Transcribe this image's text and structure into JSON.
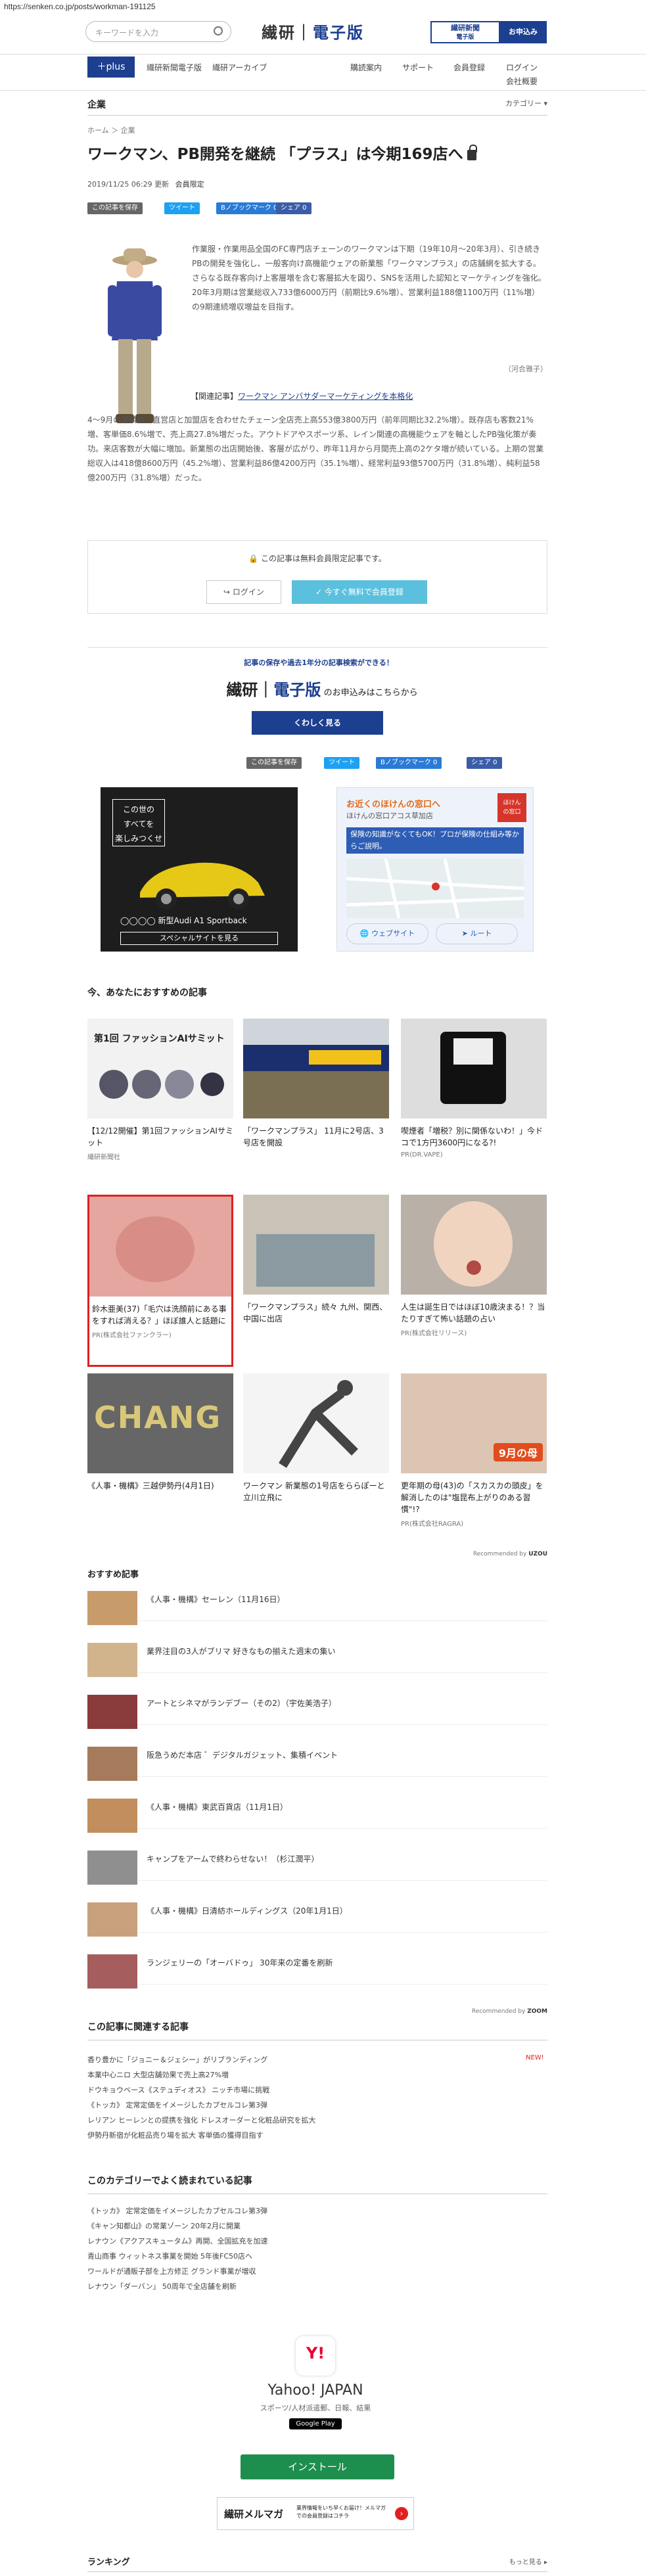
{
  "url": "https://senken.co.jp/posts/workman-191125",
  "header": {
    "search_placeholder": "キーワードを入力",
    "logo_a": "繊研",
    "logo_b": "電子版",
    "shinbun_line1": "繊研新聞",
    "shinbun_line2": "電子版",
    "subscribe": "お申込み"
  },
  "nav": {
    "plus": "plus",
    "items": [
      "繊研新聞電子版",
      "繊研アーカイブ",
      "購読案内",
      "サポート",
      "会員登録",
      "ログイン",
      "会社概要"
    ]
  },
  "category": {
    "title": "企業",
    "menu": "カテゴリー ▾"
  },
  "breadcrumb": "ホーム ＞ 企業",
  "article": {
    "title": "ワークマン、PB開発を継続 「プラス」は今期169店へ",
    "date": "2019/11/25 06:29 更新",
    "member_label": "会員限定",
    "share": {
      "save": "この記事を保存",
      "tweet": "ツイート",
      "bookmark": "Bノブックマーク 0",
      "facebook": "シェア 0"
    },
    "p1": [
      "作業服・作業用品全国のFC専門店チェーンのワークマンは下期（19年10月～20年3月）、引き続きPBの開発を強化し、一般客向け高機能ウェアの新業態「ワークマンプラス」の店舗網を拡大する。さらなる既存客向け上客層増を含む客層拡大を図り、SNSを活用した認知とマーケティングを強化。20年3月期は営業総収入733億6000万円（前期比9.6%増）、営業利益188億1100万円（11%増）の9期連続増収増益を目指す。"
    ],
    "author": "（河合雅子）",
    "related_prefix": "【関連記事】",
    "related_link": "ワークマン アンバサダーマーケティングを本格化",
    "p2": "4～9月の業績は、直営店と加盟店を合わせたチェーン全店売上高553億3800万円（前年同期比32.2%増）。既存店も客数21%増、客単価8.6%増で、売上高27.8%増だった。アウトドアやスポーツ系、レイン関連の高機能ウェアを軸としたPB強化策が奏功。来店客数が大幅に増加。新業態の出店開始後、客層が広がり、昨年11月から月間売上高の2ケタ増が続いている。上期の営業総収入は418億8600万円（45.2%増）、営業利益86億4200万円（35.1%増）、経常利益93億5700万円（31.8%増）、純利益58億200万円（31.8%増）だった。"
  },
  "members": {
    "msg": "この記事は無料会員限定記事です。",
    "login": "ログイン",
    "register": "今すぐ無料で会員登録"
  },
  "promo": {
    "band": "記事の保存や過去1年分の記事検索ができる！",
    "tail": "のお申込みはこちらから",
    "button": "くわしく見る"
  },
  "ads": {
    "car_top1": "この世の",
    "car_top2": "すべてを",
    "car_top3": "楽しみつくせ",
    "car_model": "新型Audi A1 Sportback",
    "car_btn": "スペシャルサイトを見る",
    "ins_title": "お近くのほけんの窓口へ",
    "ins_sub": "ほけんの窓口アコス草加店",
    "ins_blue": "保険の知識がなくてもOK！プロが保険の仕組み等からご説明。",
    "ins_web": "ウェブサイト",
    "ins_route": "ルート"
  },
  "reco_title": "今、あなたにおすすめの記事",
  "cards": [
    {
      "cap": "【12/12開催】第1回ファッションAIサミット",
      "src": "繊研新聞社",
      "banner": "第1回 ファッションAIサミット"
    },
    {
      "cap": "「ワークマンプラス」 11月に2号店、3号店を開設",
      "src": ""
    },
    {
      "cap": "喫煙者「増税？別に関係ないわ！」今ドコで1方円3600円になる?!",
      "src": "PR(DR.VAPE)"
    },
    {
      "cap": "鈴木亜美(37)「毛穴は洗顔前にある事をすれば消える？」ほぼ誰人と話題に",
      "src": "PR(株式会社ファンクラー)"
    },
    {
      "cap": "「ワークマンプラス」続々 九州、関西、中国に出店",
      "src": ""
    },
    {
      "cap": "人生は誕生日ではほぼ10歳決まる！？当たりすぎて怖い話題の占い",
      "src": "PR(株式会社リリース)"
    },
    {
      "cap": "《人事・機構》三越伊勢丹(4月1日)",
      "src": ""
    },
    {
      "cap": "ワークマン 新業態の1号店をららぽーと立川立飛に",
      "src": ""
    },
    {
      "cap": "更年期の母(43)の「スカスカの頭皮」を解消したのは\"塩昆布上がりのある習慣\"!?",
      "src": "PR(株式会社RAGRA)",
      "badge": "9月の母"
    }
  ],
  "recommended_by": "Recommended by",
  "osusume": {
    "title": "おすすめ記事",
    "items": [
      "《人事・機構》セーレン（11月16日）",
      "業界注目の3人がブリマ 好きなもの揃えた週末の集い",
      "アートとシネマがランデブー（その2）（宇佐美浩子）",
      "阪急うめだ本店 ゛デジタルガジェット、集積イベント",
      "《人事・機構》東武百貨店（11月1日）",
      "キャンプをアームで終わらせない！（杉江潤平）",
      "《人事・機構》日清紡ホールディングス（20年1月1日）",
      "ランジェリーの「オーバドゥ」 30年来の定番を刷新"
    ]
  },
  "related_section": {
    "title": "この記事に関連する記事",
    "new": "NEW!",
    "items": [
      "香り豊かに「ジョニー＆ジェシー」がリブランディング",
      "本業中心ニロ 大型店舗効果で売上高27%増",
      "ドウキョウベース《ステュディオス》 ニッチ市場に挑戦",
      "《トッカ》 定常定価をイメージしたカプセルコレ第3弾",
      "レリアン ヒーレンとの提携を強化 ドレスオーダーと化粧品研究を拡大",
      "伊勢丹新宿が化粧品売り場を拡大 客単価の獲得目指す"
    ]
  },
  "popular_section": {
    "title": "このカテゴリーでよく読まれている記事",
    "items": [
      "《トッカ》 定常定価をイメージしたカプセルコレ第3弾",
      "《キャン知都山》の常業ゾーン 20年2月に開業",
      "レナウン《アクアスキュータム》再開、全国拡充を加速",
      "青山商事 ウィットネス事業を開始 5年後FC50店へ",
      "ワールドが通販子部を上方修正 グランド事業が増収",
      "レナウン「ダーバン」 50周年で全店舗を刷新"
    ]
  },
  "yahoo": {
    "name": "Yahoo! JAPAN",
    "sub": "スポーツ/人材派遣郵、日報、結果",
    "store": "Google Play",
    "install": "インストール",
    "mail_title": "繊研メルマガ",
    "mail_body": "業界情報をいち早くお届け！メルマガでの会員登録はコチラ"
  },
  "ranking": {
    "title": "ランキング",
    "more": "もっと見る ▸"
  }
}
